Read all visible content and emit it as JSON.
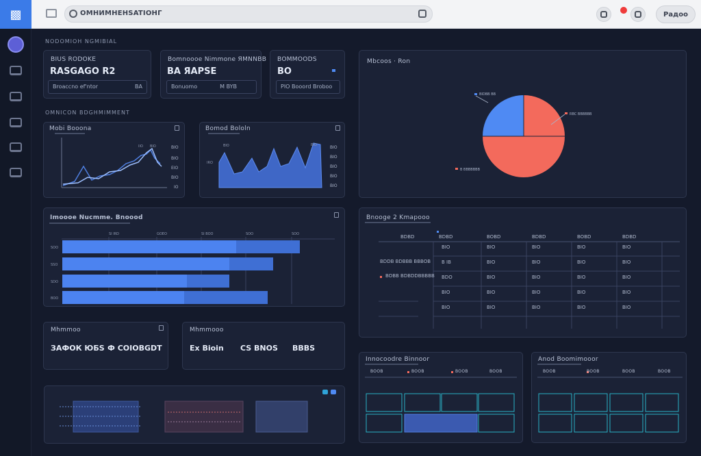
{
  "app": {
    "search_text": "ОМНИМНЕНSATIОНГ",
    "user_label": "Радоо"
  },
  "section_header_top": "NODOMIOH NGMIBIAL",
  "section_header_mid": "OMNICON BDGHMIMMENT",
  "stat_cards": [
    {
      "title": "BIUS RODOKE",
      "value": "RASGAGO R2",
      "input": "Broaccno ef'ntor",
      "input_badge": "BA"
    },
    {
      "title": "Bomnoooe Nimmone ЯMNNBB",
      "value": "BA ЯAPSE",
      "input": "Bonuomo",
      "input_badge": "M BYB"
    },
    {
      "title": "BOMMOODS",
      "value": "BO",
      "input": "PIO  Booord Broboo"
    }
  ],
  "line_chart_card": {
    "title": "Mobi Booona",
    "ticks": [
      "BIO",
      "BIO",
      "EIO",
      "BIO",
      "IO"
    ],
    "labels": [
      "IIO",
      "BIO"
    ]
  },
  "area_chart_card": {
    "title": "Bomod Bololn",
    "ticks": [
      "BIO",
      "BIO",
      "BIO",
      "BIO",
      "BIO",
      "IRO"
    ],
    "labels": [
      "BIO",
      "BIO"
    ]
  },
  "pie_card": {
    "title": "Mbcoos · Ron",
    "legend": [
      {
        "label": "BIDBB BB",
        "color": "#4f8af3"
      },
      {
        "label": "RBC BBBBBB",
        "color": "#f36a5c"
      },
      {
        "label": "B BBBBBBB",
        "color": "#f36a5c"
      }
    ]
  },
  "bar_card": {
    "title": "Imoooe Nucmme. Bnoood",
    "axis_ticks": [
      "SI IRD",
      "GOEO",
      "SI BOO",
      "SOO",
      "SOO"
    ],
    "row_labels": [
      "SOO",
      "SSO",
      "SDO",
      "BOO"
    ]
  },
  "table_card": {
    "title": "Bnooge 2 Kmapooo",
    "headers": [
      "BDBD",
      "BDBD",
      "BOBD",
      "BDBD",
      "BOBD",
      "BDBD"
    ],
    "row_labels": [
      "BDDB BDBBB BBBOB",
      "BOBB BDBDDBBBBB"
    ],
    "cells": [
      [
        "BIO",
        "BIO",
        "BIO",
        "BIO",
        "BIO"
      ],
      [
        "B IB",
        "BIO",
        "BIO",
        "BIO",
        "BIO"
      ],
      [
        "BDO",
        "BIO",
        "BIO",
        "BIO",
        "BIO"
      ],
      [
        "BIO",
        "BIO",
        "BIO",
        "BIO",
        "BIO"
      ],
      [
        "BIO",
        "BIO",
        "BIO",
        "BIO",
        "BIO"
      ]
    ]
  },
  "kpi_card_left": {
    "title": "Mhmmoo",
    "values": [
      "ЗАФОК ЮБS",
      "Ф COIOBGDT"
    ]
  },
  "kpi_card_right": {
    "title": "Mhmmooo",
    "values": [
      "Ex Bioin",
      "CS BNOS",
      "BBBS"
    ]
  },
  "small_table_left": {
    "title": "Innocoodre Binnoor",
    "headers": [
      "BOOB",
      "BOOB",
      "BOOB",
      "BOOB"
    ]
  },
  "small_table_right": {
    "title": "Anod Boomimooor",
    "headers": [
      "BOOB",
      "BOOB",
      "BOOB",
      "BOOB"
    ]
  },
  "colors": {
    "accent": "#4f8af3",
    "coral": "#f36a5c",
    "panel": "#1b2236",
    "bg": "#141a2b"
  }
}
